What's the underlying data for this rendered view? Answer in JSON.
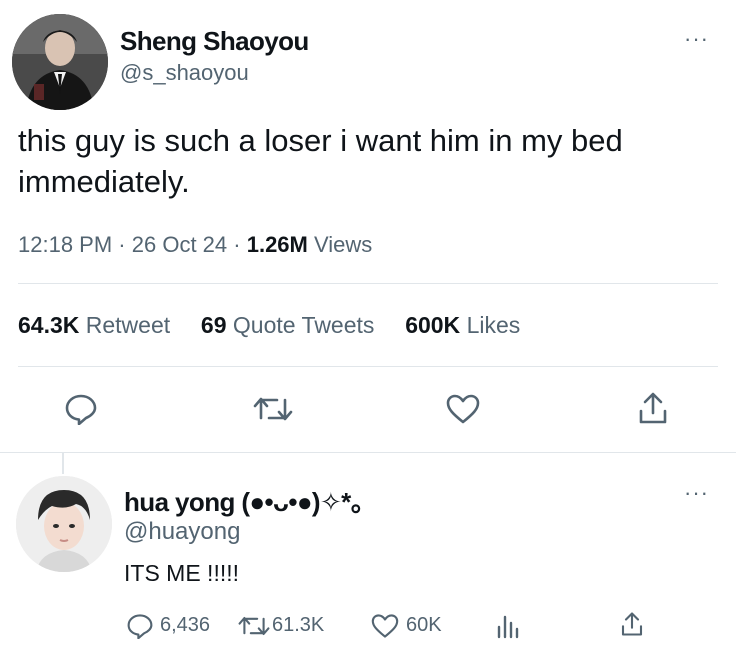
{
  "tweet": {
    "author_name": "Sheng Shaoyou",
    "author_handle": "@s_shaoyou",
    "more_label": "···",
    "text": "this guy is such a loser i want him in my bed immediately.",
    "time": "12:18 PM",
    "date": "26 Oct 24",
    "views_count": "1.26M",
    "views_label": "Views",
    "retweets_count": "64.3K",
    "retweets_label": "Retweet",
    "quotes_count": "69",
    "quotes_label": "Quote Tweets",
    "likes_count": "600K",
    "likes_label": "Likes",
    "actions": [
      "reply-icon",
      "retweet-icon",
      "like-icon",
      "share-icon"
    ]
  },
  "reply": {
    "author_name": "hua yong (●•ᴗ•●)✧*。",
    "author_handle": "@huayong",
    "more_label": "···",
    "text": "ITS ME !!!!!",
    "reply_count": "6,436",
    "retweet_count": "61.3K",
    "like_count": "60K",
    "actions": [
      "reply-icon",
      "retweet-icon",
      "like-icon",
      "analytics-icon",
      "share-icon"
    ]
  },
  "colors": {
    "text": "#0f1419",
    "muted": "#536471",
    "divider": "#e1e6ea"
  }
}
